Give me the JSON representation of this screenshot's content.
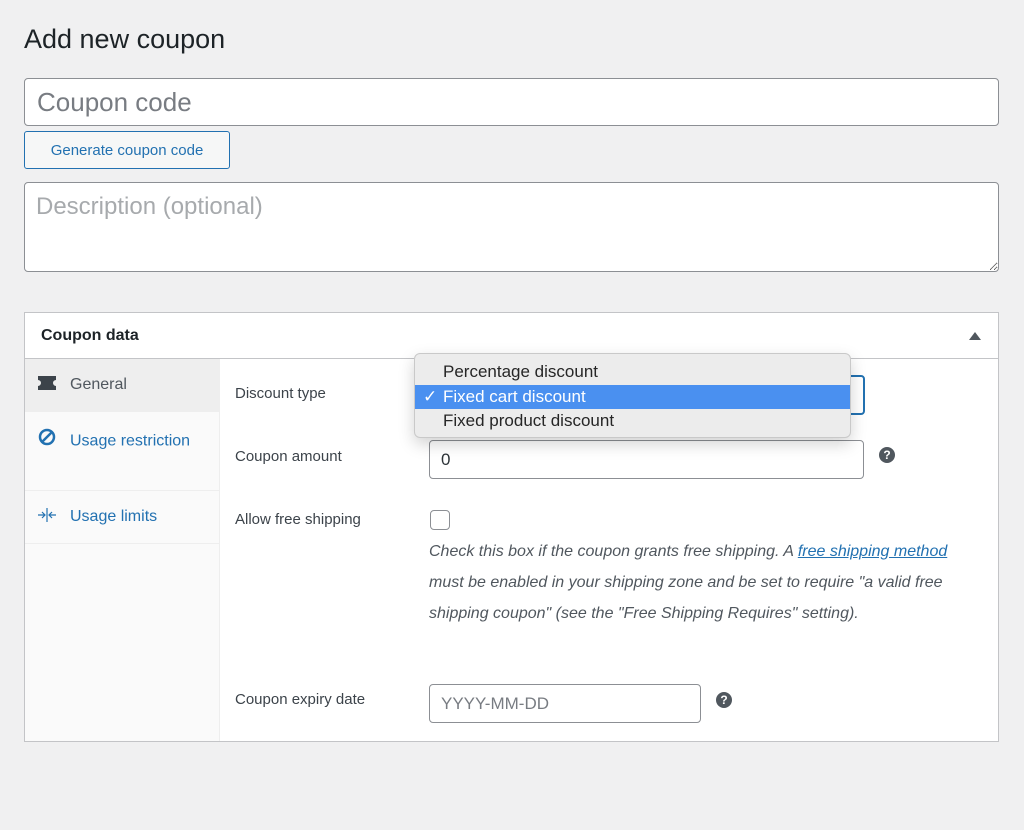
{
  "page": {
    "title": "Add new coupon",
    "coupon_code_placeholder": "Coupon code",
    "generate_button": "Generate coupon code",
    "description_placeholder": "Description (optional)"
  },
  "panel": {
    "title": "Coupon data",
    "tabs": [
      {
        "label": "General",
        "icon": "ticket-icon",
        "active": true
      },
      {
        "label": "Usage restriction",
        "icon": "block-icon",
        "active": false
      },
      {
        "label": "Usage limits",
        "icon": "arrows-in-icon",
        "active": false
      }
    ],
    "fields": {
      "discount_type": {
        "label": "Discount type",
        "options": [
          "Percentage discount",
          "Fixed cart discount",
          "Fixed product discount"
        ],
        "selected": "Fixed cart discount",
        "check_glyph": "✓"
      },
      "coupon_amount": {
        "label": "Coupon amount",
        "value": "0",
        "help": "?"
      },
      "free_shipping": {
        "label": "Allow free shipping",
        "checked": false,
        "hint_before": "Check this box if the coupon grants free shipping. A ",
        "hint_link": "free shipping method",
        "hint_after": " must be enabled in your shipping zone and be set to require \"a valid free shipping coupon\" (see the \"Free Shipping Requires\" setting)."
      },
      "expiry_date": {
        "label": "Coupon expiry date",
        "placeholder": "YYYY-MM-DD",
        "help": "?"
      }
    }
  },
  "colors": {
    "accent": "#2271b1",
    "selection": "#4a90f0",
    "background": "#f0f0f1"
  }
}
